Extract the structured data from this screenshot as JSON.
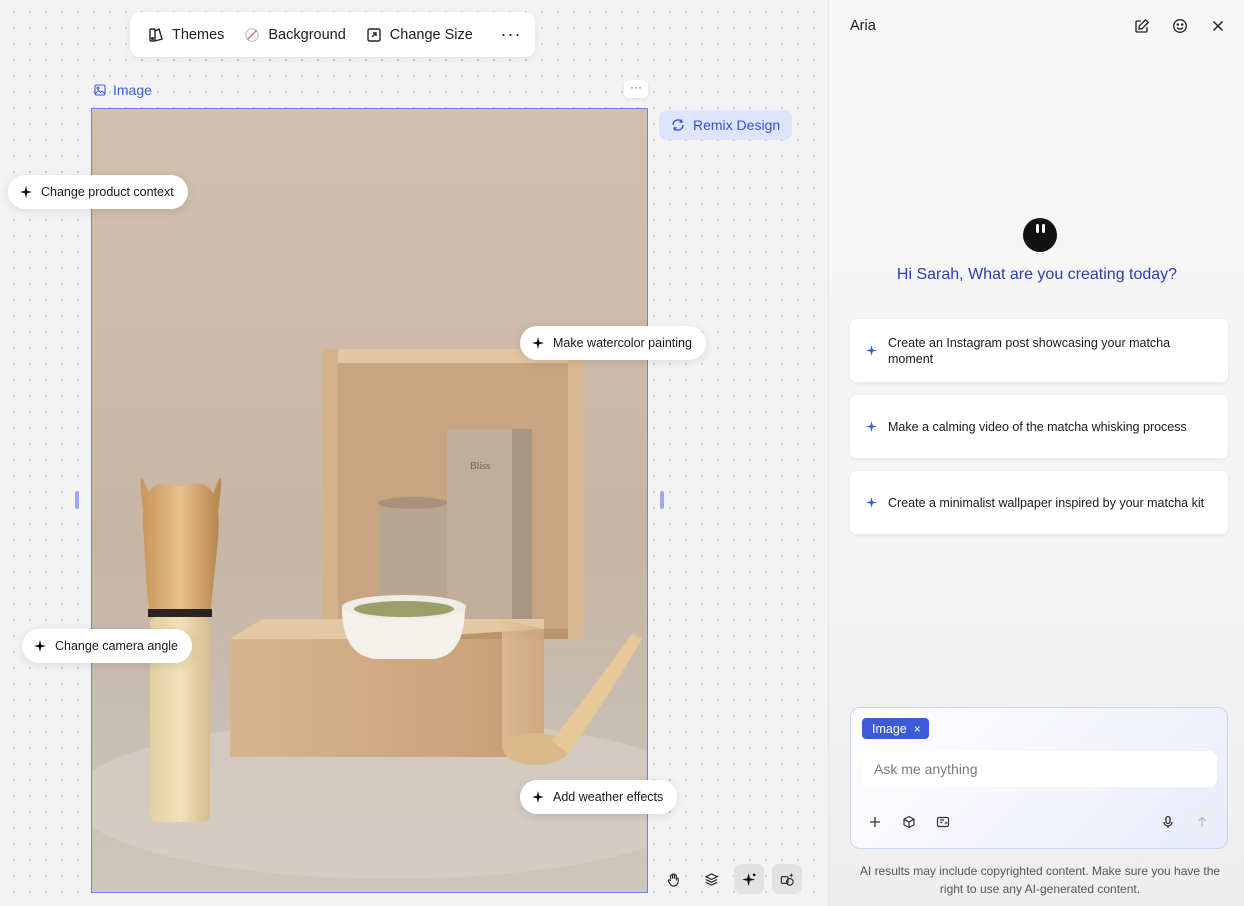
{
  "toolbar": {
    "themes_label": "Themes",
    "background_label": "Background",
    "change_size_label": "Change Size",
    "more_label": "···"
  },
  "frame": {
    "label": "Image",
    "more_label": "···",
    "remix_label": "Remix Design"
  },
  "chips": {
    "change_product_context": "Change product context",
    "make_watercolor": "Make watercolor painting",
    "change_camera_angle": "Change camera angle",
    "add_weather_effects": "Add weather effects"
  },
  "panel": {
    "title": "Aria",
    "greeting": "Hi Sarah, What are you creating today?",
    "suggestions": [
      "Create an Instagram post showcasing your matcha moment",
      "Make a calming video of the matcha whisking process",
      "Create a minimalist wallpaper inspired by your matcha kit"
    ],
    "composer": {
      "tag_label": "Image",
      "tag_remove": "×",
      "placeholder": "Ask me anything"
    },
    "disclaimer": "AI results may include copyrighted content. Make sure you have the right to use any AI-generated content."
  },
  "image_text": {
    "box_brand": "Bliss"
  },
  "colors": {
    "accent": "#3b5bdb",
    "greeting": "#2a3fb0",
    "frame_border": "#6b7ff0",
    "remix_bg": "#dde4fb"
  },
  "icons": {
    "themes": "themes-icon",
    "background": "background-icon",
    "change_size": "resize-icon",
    "image": "image-icon",
    "remix": "remix-icon",
    "sparkle": "sparkle-icon",
    "edit": "edit-icon",
    "emoji": "emoji-icon",
    "close": "close-icon",
    "plus": "plus-icon",
    "box": "cube-icon",
    "ai_tool": "ai-text-icon",
    "mic": "mic-icon",
    "send": "send-arrow-icon",
    "hand": "hand-icon",
    "layers": "layers-icon",
    "ai_sparkle": "ai-sparkle-icon",
    "ai_shapes": "ai-shapes-icon"
  }
}
